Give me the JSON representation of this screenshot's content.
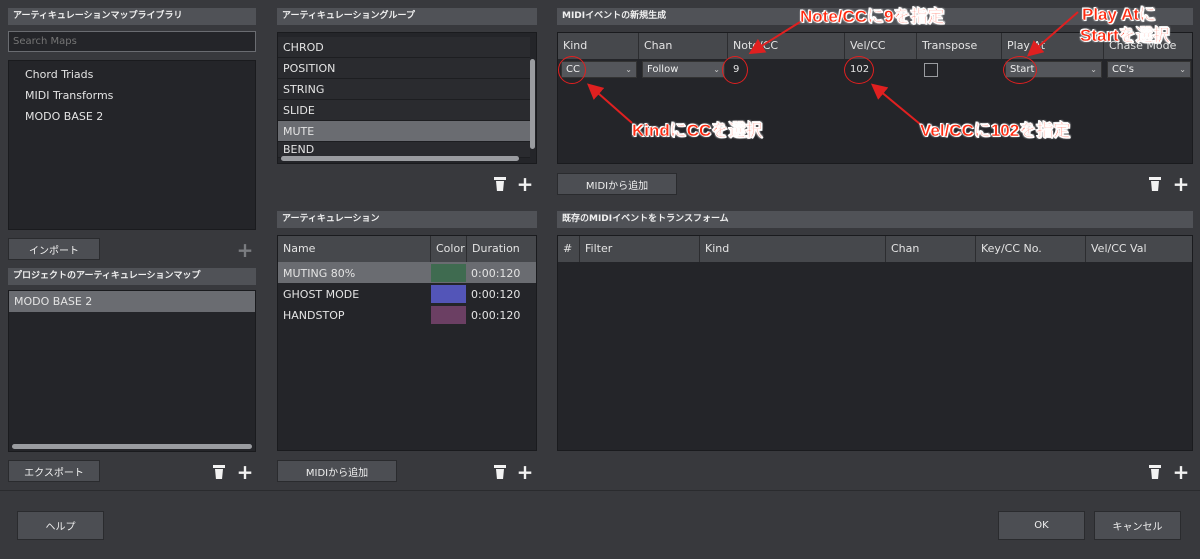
{
  "library": {
    "header": "アーティキュレーションマップライブラリ",
    "search_placeholder": "Search Maps",
    "items": [
      "Chord Triads",
      "MIDI Transforms",
      "MODO BASE 2"
    ],
    "import_label": "インポート"
  },
  "project": {
    "header": "プロジェクトのアーティキュレーションマップ",
    "items": [
      "MODO BASE 2"
    ],
    "export_label": "エクスポート"
  },
  "groups": {
    "header": "アーティキュレーショングループ",
    "items": [
      "CHROD",
      "POSITION",
      "STRING",
      "SLIDE",
      "MUTE",
      "BEND"
    ],
    "selected": "MUTE"
  },
  "articulations": {
    "header": "アーティキュレーション",
    "columns": [
      "Name",
      "Color",
      "Duration"
    ],
    "rows": [
      {
        "name": "MUTING 80%",
        "color": "#3f6b50",
        "duration": "0:00:120"
      },
      {
        "name": "GHOST MODE",
        "color": "#5355b8",
        "duration": "0:00:120"
      },
      {
        "name": "HANDSTOP",
        "color": "#6b3f63",
        "duration": "0:00:120"
      }
    ],
    "midi_add_label": "MIDIから追加"
  },
  "new_event": {
    "header": "MIDIイベントの新規生成",
    "columns": [
      "Kind",
      "Chan",
      "Note/CC",
      "Vel/CC",
      "Transpose",
      "Play At",
      "Chase Mode"
    ],
    "row": {
      "kind": "CC",
      "chan": "Follow",
      "note_cc": "9",
      "vel_cc": "102",
      "transpose_checked": false,
      "play_at": "Start",
      "chase_mode": "CC's"
    },
    "midi_add_label": "MIDIから追加"
  },
  "transform": {
    "header": "既存のMIDIイベントをトランスフォーム",
    "columns": [
      "#",
      "Filter",
      "Kind",
      "Chan",
      "Key/CC No.",
      "Vel/CC Val"
    ]
  },
  "footer": {
    "help_label": "ヘルプ",
    "ok_label": "OK",
    "cancel_label": "キャンセル"
  },
  "annotations": {
    "note_cc": "Note/CCに9を指定",
    "play_at_1": "Play Atに",
    "play_at_2": "Startを選択",
    "kind": "KindにCCを選択",
    "vel_cc": "Vel/CCに102を指定",
    "color": "#ff2a10"
  },
  "icons": [
    "plus-icon",
    "trash-icon",
    "chevron-down-icon"
  ]
}
